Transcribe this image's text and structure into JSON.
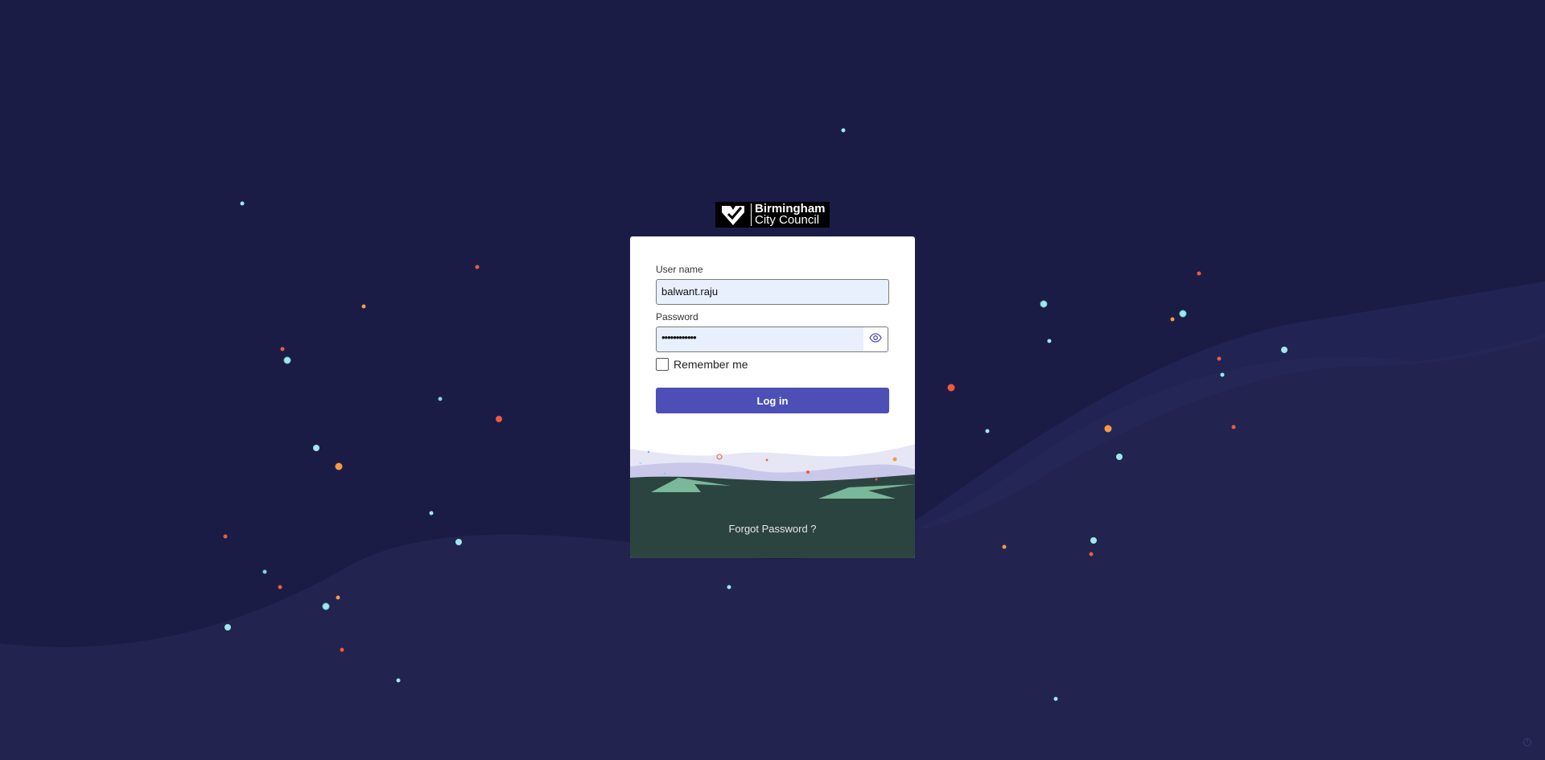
{
  "brand": {
    "line1": "Birmingham",
    "line2": "City Council",
    "logo_icon": "heart-logo-icon"
  },
  "form": {
    "username_label": "User name",
    "username_value": "balwant.raju",
    "password_label": "Password",
    "password_value": "••••••••••••",
    "show_password_icon": "eye-icon",
    "remember_label": "Remember me",
    "remember_checked": false,
    "login_label": "Log in",
    "forgot_label": "Forgot Password ?"
  },
  "colors": {
    "background": "#1b1c46",
    "accent_button": "#4b4fb6",
    "input_fill": "#e8f0fe",
    "scene_ground": "#2c4440",
    "scene_hills": "#79b89a",
    "scene_mist": "#c9c8ea",
    "particle_cyan": "#9fe7ee",
    "particle_red": "#ef5a3c",
    "particle_orange": "#f59a45"
  }
}
